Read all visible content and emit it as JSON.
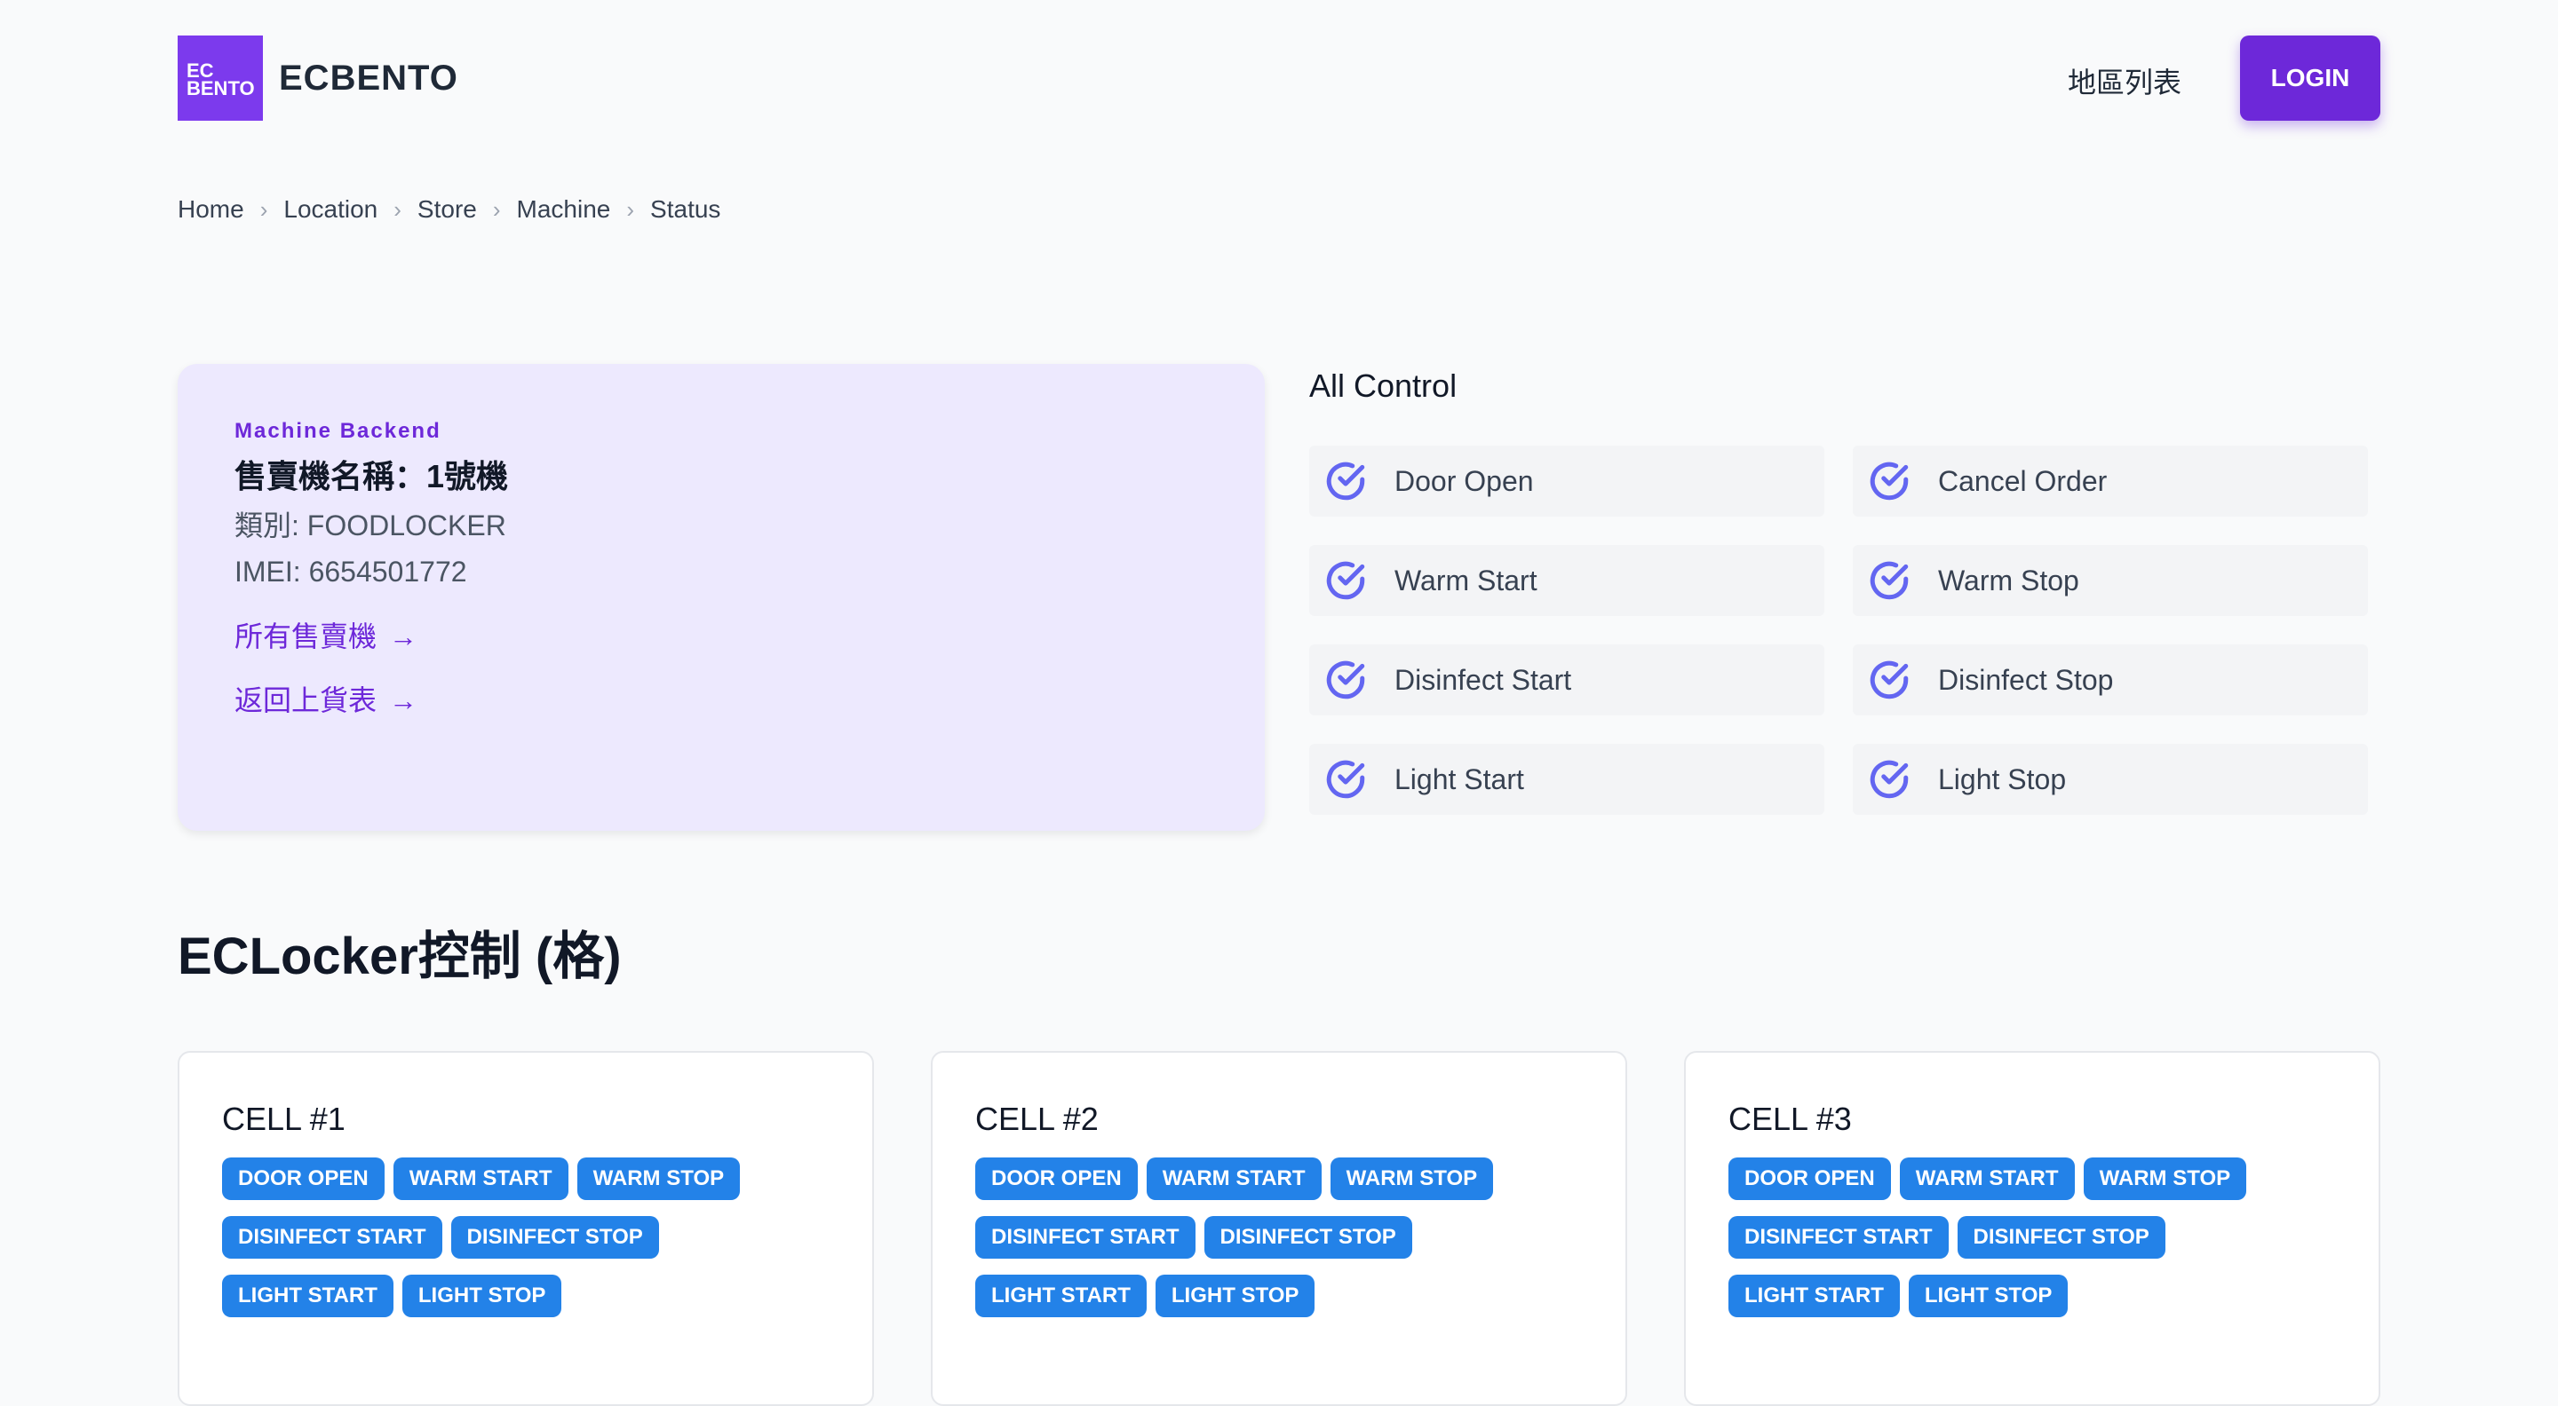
{
  "header": {
    "logo_text_1": "EC",
    "logo_text_2": "BENTO",
    "brand": "ECBENTO",
    "nav_link": "地區列表",
    "login_label": "LOGIN"
  },
  "breadcrumb": [
    "Home",
    "Location",
    "Store",
    "Machine",
    "Status"
  ],
  "machine": {
    "eyebrow": "Machine Backend",
    "name": "售賣機名稱：1號機",
    "category": "類別: FOODLOCKER",
    "imei": "IMEI: 6654501772",
    "link_all": "所有售賣機",
    "link_back": "返回上貨表",
    "arrow": "→"
  },
  "all_control": {
    "title": "All Control",
    "buttons": [
      {
        "label": "Door Open"
      },
      {
        "label": "Cancel Order"
      },
      {
        "label": "Warm Start"
      },
      {
        "label": "Warm Stop"
      },
      {
        "label": "Disinfect Start"
      },
      {
        "label": "Disinfect Stop"
      },
      {
        "label": "Light Start"
      },
      {
        "label": "Light Stop"
      }
    ]
  },
  "section_title": "ECLocker控制 (格)",
  "cells": [
    {
      "title": "CELL #1",
      "rows": [
        [
          "DOOR OPEN",
          "WARM START",
          "WARM STOP"
        ],
        [
          "DISINFECT START",
          "DISINFECT STOP"
        ],
        [
          "LIGHT START",
          "LIGHT STOP"
        ]
      ]
    },
    {
      "title": "CELL #2",
      "rows": [
        [
          "DOOR OPEN",
          "WARM START",
          "WARM STOP"
        ],
        [
          "DISINFECT START",
          "DISINFECT STOP"
        ],
        [
          "LIGHT START",
          "LIGHT STOP"
        ]
      ]
    },
    {
      "title": "CELL #3",
      "rows": [
        [
          "DOOR OPEN",
          "WARM START",
          "WARM STOP"
        ],
        [
          "DISINFECT START",
          "DISINFECT STOP"
        ],
        [
          "LIGHT START",
          "LIGHT STOP"
        ]
      ]
    }
  ],
  "colors": {
    "brand": "#6d28d9",
    "pill": "#2382e8",
    "card_bg": "#ede9fe",
    "check_icon": "#6366f1"
  }
}
